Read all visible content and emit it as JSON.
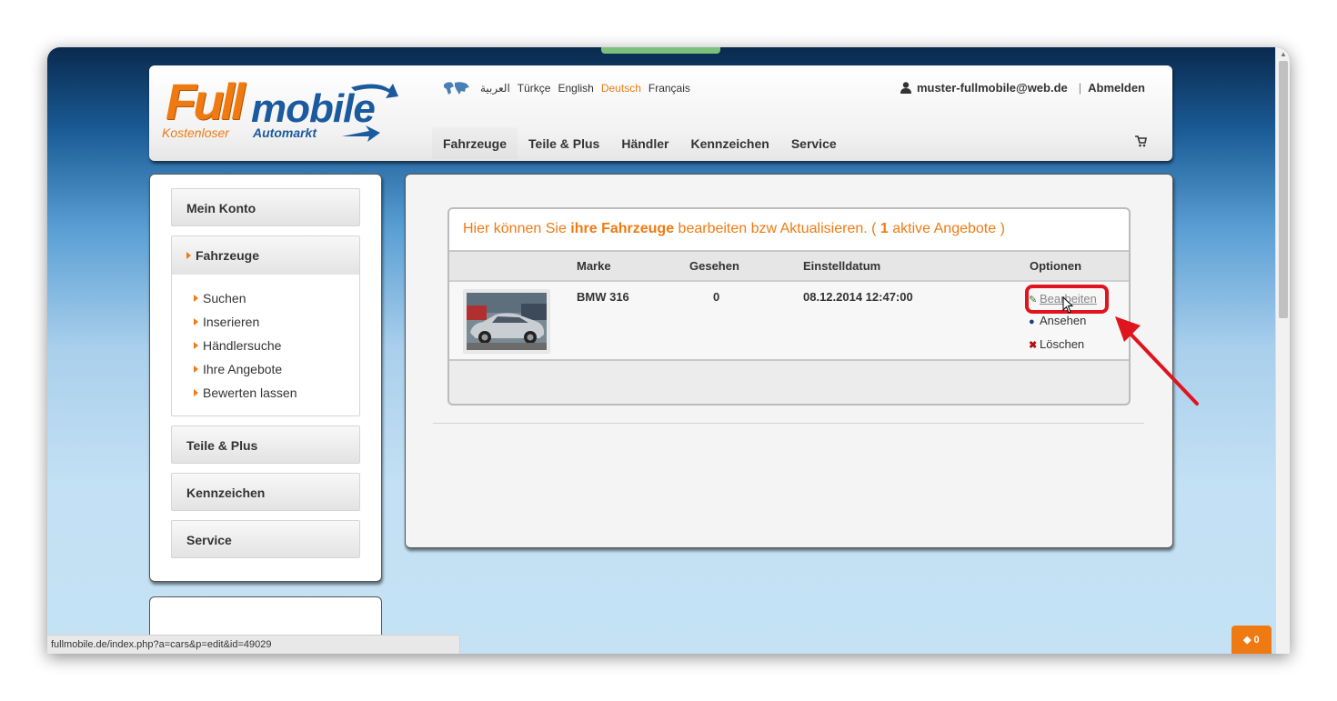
{
  "header": {
    "logo": {
      "brand_part1": "Full",
      "brand_part2": "mobile",
      "slogan_part1": "Kostenloser",
      "slogan_part2": "Automarkt"
    },
    "languages": [
      "العربية",
      "Türkçe",
      "English",
      "Deutsch",
      "Français"
    ],
    "active_language": "Deutsch",
    "user_email": "muster-fullmobile@web.de",
    "separator": "|",
    "logout_label": "Abmelden",
    "nav": [
      "Fahrzeuge",
      "Teile & Plus",
      "Händler",
      "Kennzeichen",
      "Service"
    ],
    "active_nav": "Fahrzeuge"
  },
  "sidebar": {
    "items": [
      {
        "label": "Mein Konto"
      },
      {
        "label": "Fahrzeuge",
        "expanded": true,
        "sub": [
          "Suchen",
          "Inserieren",
          "Händlersuche",
          "Ihre Angebote",
          "Bewerten lassen"
        ]
      },
      {
        "label": "Teile & Plus"
      },
      {
        "label": "Kennzeichen"
      },
      {
        "label": "Service"
      }
    ]
  },
  "panel": {
    "title_pre": "Hier können Sie ",
    "title_bold": "ihre Fahrzeuge",
    "title_mid": " bearbeiten bzw Aktualisieren. ( ",
    "count": "1",
    "title_post": " aktive Angebote )",
    "columns": {
      "marke": "Marke",
      "gesehen": "Gesehen",
      "einstelldatum": "Einstelldatum",
      "optionen": "Optionen"
    },
    "rows": [
      {
        "marke": "BMW 316",
        "gesehen": "0",
        "einstelldatum": "08.12.2014 12:47:00",
        "options": {
          "edit": "Bearbeiten",
          "view": "Ansehen",
          "delete": "Löschen"
        }
      }
    ]
  },
  "status_bar": {
    "url": "fullmobile.de/index.php?a=cars&p=edit&id=49029"
  },
  "chat": {
    "count": "0"
  },
  "colors": {
    "accent": "#f07a12",
    "brand_blue": "#1b5a9e",
    "highlight": "#e0141e"
  }
}
